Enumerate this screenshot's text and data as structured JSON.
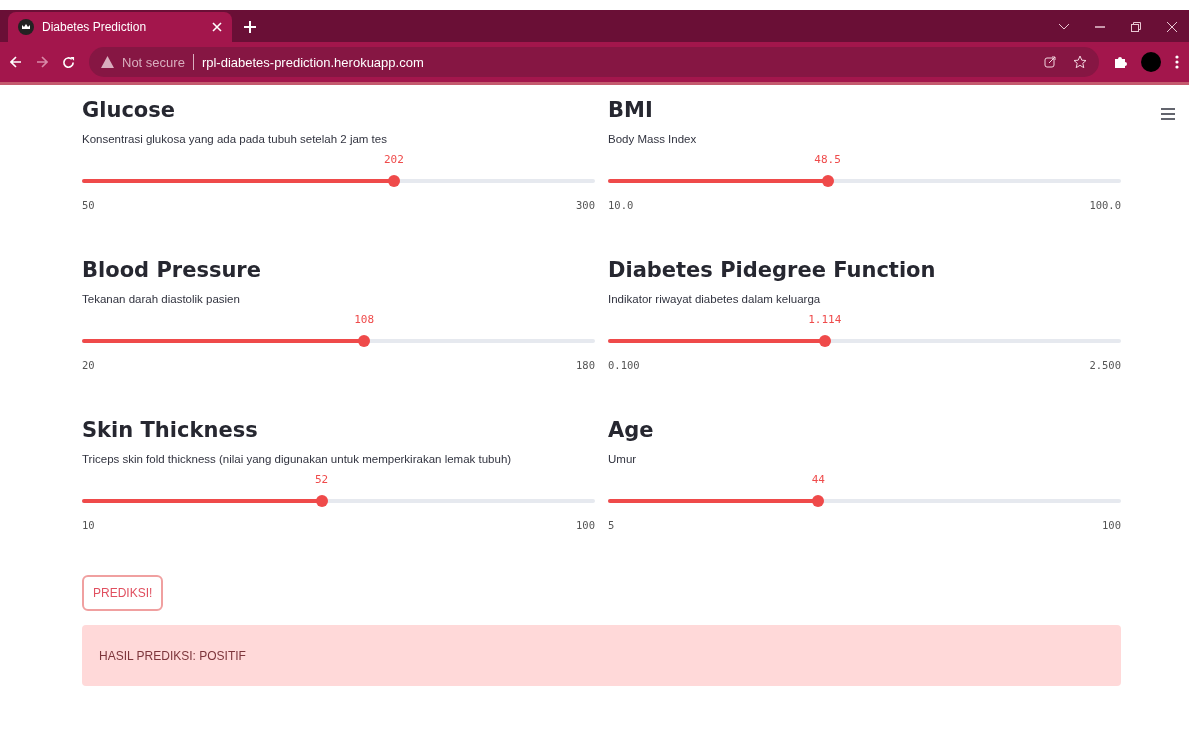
{
  "browser": {
    "tabs": [
      {
        "title": "Diabetes Prediction",
        "selected": true
      }
    ],
    "security": "Not secure",
    "url": "rpl-diabetes-prediction.herokuapp.com"
  },
  "sliders": [
    {
      "title": "Glucose",
      "description": "Konsentrasi glukosa yang ada pada tubuh setelah 2 jam tes",
      "value": "202",
      "min": "50",
      "max": "300",
      "level": 0.608
    },
    {
      "title": "BMI",
      "description": "Body Mass Index",
      "value": "48.5",
      "min": "10.0",
      "max": "100.0",
      "level": 0.428
    },
    {
      "title": "Blood Pressure",
      "description": "Tekanan darah diastolik pasien",
      "value": "108",
      "min": "20",
      "max": "180",
      "level": 0.55
    },
    {
      "title": "Diabetes Pidegree Function",
      "description": "Indikator riwayat diabetes dalam keluarga",
      "value": "1.114",
      "min": "0.100",
      "max": "2.500",
      "level": 0.4225
    },
    {
      "title": "Skin Thickness",
      "description": "Triceps skin fold thickness (nilai yang digunakan untuk memperkirakan lemak tubuh)",
      "value": "52",
      "min": "10",
      "max": "100",
      "level": 0.467
    },
    {
      "title": "Age",
      "description": "Umur",
      "value": "44",
      "min": "5",
      "max": "100",
      "level": 0.41
    }
  ],
  "button": "PREDIKSI!",
  "result": "HASIL PREDIKSI: POSITIF"
}
